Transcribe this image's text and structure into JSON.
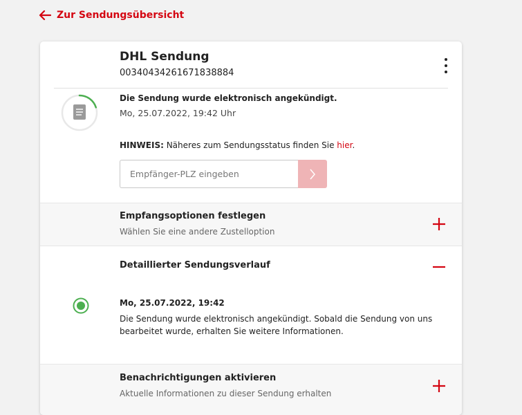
{
  "back_link": {
    "label": "Zur Sendungsübersicht"
  },
  "shipment": {
    "title": "DHL Sendung",
    "tracking_number": "00340434261671838884",
    "status_text": "Die Sendung wurde elektronisch angekündigt.",
    "status_date": "Mo, 25.07.2022, 19:42 Uhr",
    "progress_fraction": 0.2
  },
  "hint": {
    "prefix": "HINWEIS:",
    "text": " Näheres zum Sendungsstatus finden Sie ",
    "link": "hier",
    "suffix": "."
  },
  "plz": {
    "placeholder": "Empfänger-PLZ eingeben"
  },
  "sections": {
    "receive_options": {
      "title": "Empfangsoptionen festlegen",
      "subtitle": "Wählen Sie eine andere Zustelloption"
    },
    "history": {
      "title": "Detaillierter Sendungsverlauf",
      "events": [
        {
          "date": "Mo, 25.07.2022, 19:42",
          "text": "Die Sendung wurde elektronisch angekündigt. Sobald die Sendung von uns bearbeitet wurde, erhalten Sie weitere Informationen."
        }
      ]
    },
    "notifications": {
      "title": "Benachrichtigungen aktivieren",
      "subtitle": "Aktuelle Informationen zu dieser Sendung erhalten"
    }
  },
  "colors": {
    "brand_red": "#d40511",
    "status_green": "#4caf50",
    "submit_disabled": "#efb4b6",
    "icons": [
      "arrow-left-icon",
      "more-vertical-icon",
      "document-icon",
      "chevron-right-icon",
      "plus-icon",
      "minus-icon",
      "status-dot-icon"
    ]
  }
}
